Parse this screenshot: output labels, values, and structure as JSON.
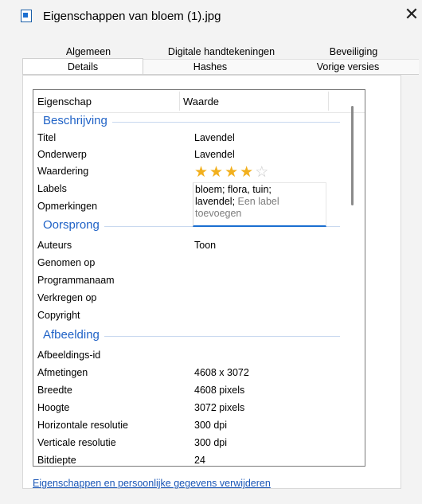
{
  "window": {
    "title": "Eigenschappen van bloem (1).jpg",
    "close_glyph": "✕",
    "icon": "image-file-icon"
  },
  "tabs_row1": [
    "Algemeen",
    "Digitale handtekeningen",
    "Beveiliging"
  ],
  "tabs_row2": [
    "Details",
    "Hashes",
    "Vorige versies"
  ],
  "active_tab": "Details",
  "table": {
    "col_property": "Eigenschap",
    "col_value": "Waarde"
  },
  "sections": {
    "description": "Beschrijving",
    "origin": "Oorsprong",
    "image": "Afbeelding"
  },
  "description": {
    "titel": {
      "k": "Titel",
      "v": "Lavendel"
    },
    "onderwerp": {
      "k": "Onderwerp",
      "v": "Lavendel"
    },
    "waardering": {
      "k": "Waardering",
      "rating": 4,
      "max": 5
    },
    "labels": {
      "k": "Labels"
    },
    "opmerkingen": {
      "k": "Opmerkingen"
    }
  },
  "tag_editor": {
    "line1": "bloem; flora, tuin;",
    "line2a": "lavendel;",
    "line2b": " Een label",
    "line3": "toevoegen"
  },
  "origin": {
    "auteurs": {
      "k": "Auteurs",
      "v": "Toon"
    },
    "genomen": {
      "k": "Genomen op",
      "v": ""
    },
    "programma": {
      "k": "Programmanaam",
      "v": ""
    },
    "verkregen": {
      "k": "Verkregen op",
      "v": ""
    },
    "copyright": {
      "k": "Copyright",
      "v": ""
    }
  },
  "image": {
    "id": {
      "k": "Afbeeldings-id",
      "v": ""
    },
    "afmetingen": {
      "k": "Afmetingen",
      "v": "4608 x 3072"
    },
    "breedte": {
      "k": "Breedte",
      "v": "4608 pixels"
    },
    "hoogte": {
      "k": "Hoogte",
      "v": "3072 pixels"
    },
    "hres": {
      "k": "Horizontale resolutie",
      "v": "300 dpi"
    },
    "vres": {
      "k": "Verticale resolutie",
      "v": "300 dpi"
    },
    "bitdiepte": {
      "k": "Bitdiepte",
      "v": "24"
    }
  },
  "remove_link": "Eigenschappen en persoonlijke gegevens verwijderen",
  "colors": {
    "accent": "#1f62c6",
    "star_on": "#f2b01e",
    "star_off": "#c9c9c9",
    "link": "#1a56b6"
  }
}
